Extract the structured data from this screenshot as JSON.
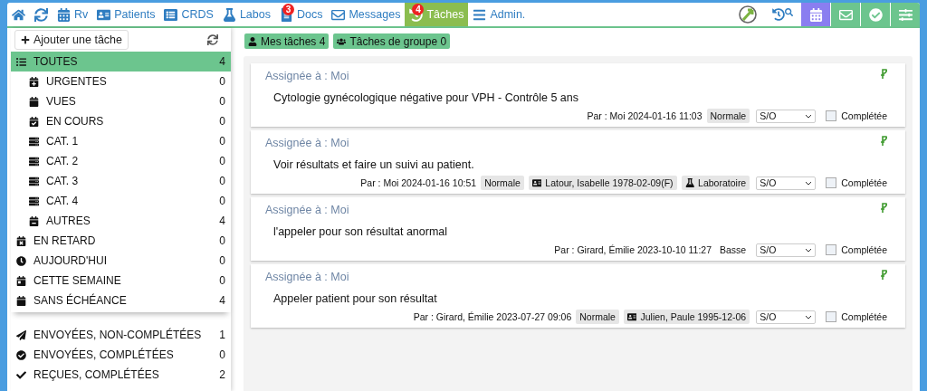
{
  "nav": {
    "items": [
      {
        "selected": false
      },
      {
        "selected": false
      },
      {
        "label": "Rv",
        "selected": false
      },
      {
        "label": "Patients",
        "selected": false
      },
      {
        "label": "CRDS",
        "selected": false
      },
      {
        "label": "Labos",
        "selected": false
      },
      {
        "label": "Docs",
        "badge": "3",
        "selected": false
      },
      {
        "label": "Messages",
        "selected": false
      },
      {
        "label": "Tâches",
        "badge": "4",
        "selected": true
      },
      {
        "label": "Admin.",
        "selected": false
      }
    ],
    "right_buttons": [
      {
        "selected": true
      },
      {
        "selected": false
      },
      {
        "selected": false
      },
      {
        "selected": false
      }
    ]
  },
  "sidebar": {
    "add_button": "Ajouter une tâche",
    "groups": [
      [
        {
          "label": "TOUTES",
          "count": "4",
          "kind": "main",
          "selected": true
        },
        {
          "label": "URGENTES",
          "count": "0",
          "kind": "sub",
          "selected": false
        },
        {
          "label": "VUES",
          "count": "0",
          "kind": "sub",
          "selected": false
        },
        {
          "label": "EN COURS",
          "count": "0",
          "kind": "sub",
          "selected": false
        },
        {
          "label": "CAT. 1",
          "count": "0",
          "kind": "sub",
          "selected": false
        },
        {
          "label": "CAT. 2",
          "count": "0",
          "kind": "sub",
          "selected": false
        },
        {
          "label": "CAT. 3",
          "count": "0",
          "kind": "sub",
          "selected": false
        },
        {
          "label": "CAT. 4",
          "count": "0",
          "kind": "sub",
          "selected": false
        },
        {
          "label": "AUTRES",
          "count": "4",
          "kind": "sub",
          "selected": false
        },
        {
          "label": "EN RETARD",
          "count": "0",
          "kind": "main",
          "selected": false
        },
        {
          "label": "AUJOURD'HUI",
          "count": "0",
          "kind": "main",
          "selected": false
        },
        {
          "label": "CETTE SEMAINE",
          "count": "0",
          "kind": "main",
          "selected": false
        },
        {
          "label": "SANS ÉCHÉANCE",
          "count": "4",
          "kind": "main",
          "selected": false
        }
      ],
      [
        {
          "label": "ENVOYÉES, NON-COMPLÉTÉES",
          "count": "1",
          "kind": "main",
          "selected": false
        },
        {
          "label": "ENVOYÉES, COMPLÉTÉES",
          "count": "0",
          "kind": "main",
          "selected": false
        },
        {
          "label": "REÇUES, COMPLÉTÉES",
          "count": "2",
          "kind": "main",
          "selected": false
        }
      ]
    ]
  },
  "filters": [
    {
      "label": "Mes tâches 4"
    },
    {
      "label": "Tâches de groupe 0"
    }
  ],
  "tasks": [
    {
      "assigned": "Assignée à : Moi",
      "text": "Cytologie gynécologique négative pour VPH - Contrôle 5 ans",
      "by": "Par : Moi 2024-01-16 11:03",
      "priority": {
        "text": "Normale",
        "highlighted": true
      },
      "status": "S/O",
      "done_label": "Complétée",
      "completed": false
    },
    {
      "assigned": "Assignée à : Moi",
      "text": "Voir résultats et faire un suivi au patient.",
      "by": "Par : Moi 2024-01-16 10:51",
      "priority": {
        "text": "Normale",
        "highlighted": true
      },
      "tags": [
        {
          "kind": "patient",
          "text": "Latour, Isabelle 1978-02-09(F)"
        },
        {
          "kind": "lab",
          "text": "Laboratoire"
        }
      ],
      "status": "S/O",
      "done_label": "Complétée",
      "completed": false
    },
    {
      "assigned": "Assignée à : Moi",
      "text": "l'appeler pour son résultat anormal",
      "by": "Par : Girard, Émilie 2023-10-10 11:27",
      "priority": {
        "text": "Basse",
        "highlighted": false
      },
      "status": "S/O",
      "done_label": "Complétée",
      "completed": false
    },
    {
      "assigned": "Assignée à : Moi",
      "text": "Appeler patient pour son résultat",
      "by": "Par : Girard, Émilie 2023-07-27 09:06",
      "priority": {
        "text": "Normale",
        "highlighted": true
      },
      "tags": [
        {
          "kind": "patient",
          "text": "Julien, Paule 1995-12-06"
        }
      ],
      "status": "S/O",
      "done_label": "Complétée",
      "completed": false
    }
  ]
}
